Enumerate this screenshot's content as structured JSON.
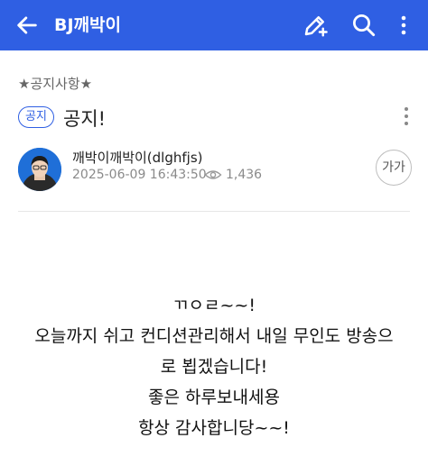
{
  "appbar": {
    "title": "BJ깨박이",
    "color": "#2f5fe3",
    "icons": [
      "arrow-back-icon",
      "pencil-plus-icon",
      "search-icon",
      "more-vert-icon"
    ]
  },
  "post": {
    "category": "★공지사항★",
    "tag": "공지",
    "title": "공지!",
    "author": "깨박이깨박이(dlghfjs)",
    "date": "2025-06-09 16:43:50",
    "views": "1,436",
    "font_size_button": "가가",
    "body_lines": [
      "ㄲㅇㄹ~~!",
      "오늘까지 쉬고 컨디션관리해서 내일 무인도 방송으",
      "로 뵙겠습니다!",
      "좋은 하루보내세용",
      "항상 감사합니당~~!"
    ]
  }
}
